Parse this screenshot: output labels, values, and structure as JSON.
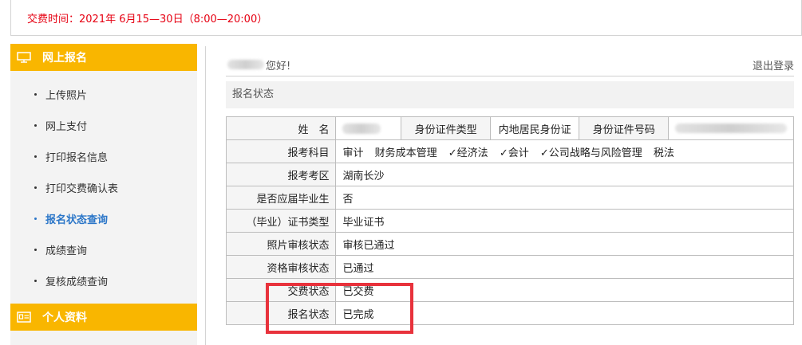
{
  "notice": {
    "text": "交费时间：2021年 6月15—30日（8:00—20:00）"
  },
  "sidebar": {
    "section1_title": "网上报名",
    "section1_icon": "monitor-icon",
    "items": [
      {
        "label": "上传照片",
        "active": false
      },
      {
        "label": "网上支付",
        "active": false
      },
      {
        "label": "打印报名信息",
        "active": false
      },
      {
        "label": "打印交费确认表",
        "active": false
      },
      {
        "label": "报名状态查询",
        "active": true
      },
      {
        "label": "成绩查询",
        "active": false
      },
      {
        "label": "复核成绩查询",
        "active": false
      }
    ],
    "section2_title": "个人资料",
    "section2_icon": "id-card-icon",
    "accent_color": "#f9b600",
    "active_color": "#2b76c8"
  },
  "header": {
    "greeting": "您好!",
    "logout": "退出登录"
  },
  "status_section": {
    "title": "报名状态"
  },
  "table": {
    "name_label": "姓　名",
    "id_type_label": "身份证件类型",
    "id_type_value": "内地居民身份证",
    "id_number_label": "身份证件号码",
    "rows": [
      {
        "label": "报考科目",
        "subjects": [
          "审计",
          "财务成本管理",
          "✓经济法",
          "✓会计",
          "✓公司战略与风险管理",
          "税法"
        ]
      },
      {
        "label": "报考考区",
        "value": "湖南长沙"
      },
      {
        "label": "是否应届毕业生",
        "value": "否"
      },
      {
        "label": "（毕业）证书类型",
        "value": "毕业证书"
      },
      {
        "label": "照片审核状态",
        "value": "审核已通过"
      },
      {
        "label": "资格审核状态",
        "value": "已通过"
      },
      {
        "label": "交费状态",
        "value": "已交费"
      },
      {
        "label": "报名状态",
        "value": "已完成"
      }
    ]
  },
  "colors": {
    "notice_text": "#e60012",
    "highlight_box": "#e8323c"
  }
}
